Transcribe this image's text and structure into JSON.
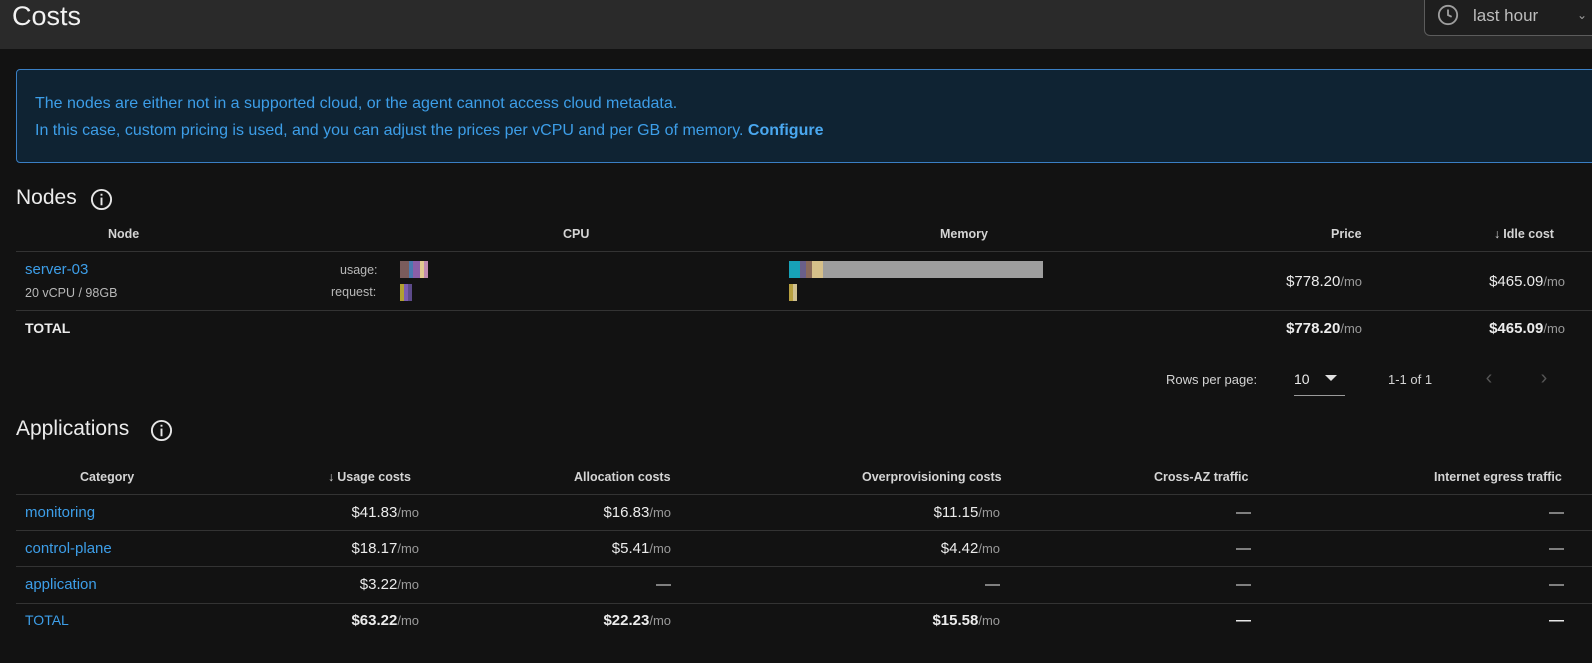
{
  "header": {
    "title": "Costs",
    "time_range": "last hour"
  },
  "alert": {
    "line1": "The nodes are either not in a supported cloud, or the agent cannot access cloud metadata.",
    "line2": "In this case, custom pricing is used, and you can adjust the prices per vCPU and per GB of memory. ",
    "link": "Configure"
  },
  "nodes": {
    "title": "Nodes",
    "columns": [
      "Node",
      "CPU",
      "Memory",
      "Price",
      "Idle cost"
    ],
    "rows": [
      {
        "name": "server-03",
        "spec": "20 vCPU / 98GB",
        "usage_label": "usage:",
        "request_label": "request:",
        "price": "$778.20",
        "price_unit": "/mo",
        "idle": "$465.09",
        "idle_unit": "/mo"
      }
    ],
    "total": {
      "label": "TOTAL",
      "price": "$778.20",
      "price_unit": "/mo",
      "idle": "$465.09",
      "idle_unit": "/mo"
    },
    "pagination": {
      "rows_per_page_label": "Rows per page:",
      "rows_per_page": "10",
      "range": "1-1 of 1"
    },
    "colors": {
      "cpu_usage": [
        "#7a5c5c",
        "#4a7ab0",
        "#8a5fa8",
        "#e0c890",
        "#c08ab0"
      ],
      "cpu_request": [
        "#b0a030",
        "#7a5cb0",
        "#5c4a8a"
      ],
      "mem_usage": [
        "#17a2b8",
        "#6a5f8a",
        "#8a6a5a",
        "#d6c08a",
        "#9e9e9e"
      ],
      "mem_request": [
        "#b8a040",
        "#d0c090"
      ]
    }
  },
  "applications": {
    "title": "Applications",
    "columns": [
      "Category",
      "Usage costs",
      "Allocation costs",
      "Overprovisioning costs",
      "Cross-AZ traffic",
      "Internet egress traffic"
    ],
    "rows": [
      {
        "category": "monitoring",
        "usage": "$41.83",
        "allocation": "$16.83",
        "overprov": "$11.15",
        "cross_az": "—",
        "egress": "—"
      },
      {
        "category": "control-plane",
        "usage": "$18.17",
        "allocation": "$5.41",
        "overprov": "$4.42",
        "cross_az": "—",
        "egress": "—"
      },
      {
        "category": "application",
        "usage": "$3.22",
        "allocation": "—",
        "overprov": "—",
        "cross_az": "—",
        "egress": "—"
      }
    ],
    "total": {
      "category": "TOTAL",
      "usage": "$63.22",
      "allocation": "$22.23",
      "overprov": "$15.58",
      "cross_az": "—",
      "egress": "—"
    },
    "unit": "/mo"
  }
}
